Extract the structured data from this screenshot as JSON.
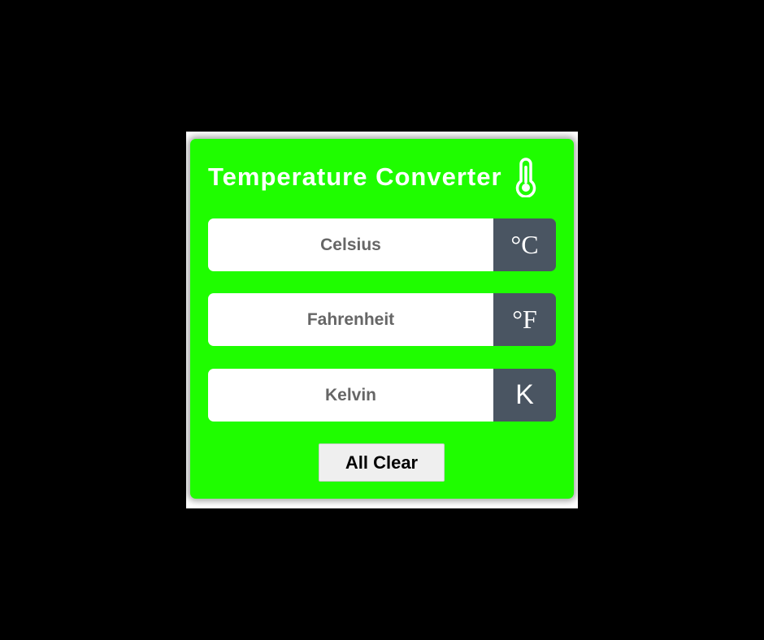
{
  "app": {
    "title": "Temperature Converter",
    "title_icon": "thermometer-icon"
  },
  "fields": [
    {
      "placeholder": "Celsius",
      "value": "",
      "unit": "°C"
    },
    {
      "placeholder": "Fahrenheit",
      "value": "",
      "unit": "°F"
    },
    {
      "placeholder": "Kelvin",
      "value": "",
      "unit": "K"
    }
  ],
  "actions": {
    "clear_label": "All Clear"
  },
  "colors": {
    "page_background": "#000000",
    "card_background": "#1ffd00",
    "unit_background": "#4a5562",
    "button_background": "#efefef",
    "text_white": "#ffffff",
    "placeholder_text": "#666666"
  }
}
